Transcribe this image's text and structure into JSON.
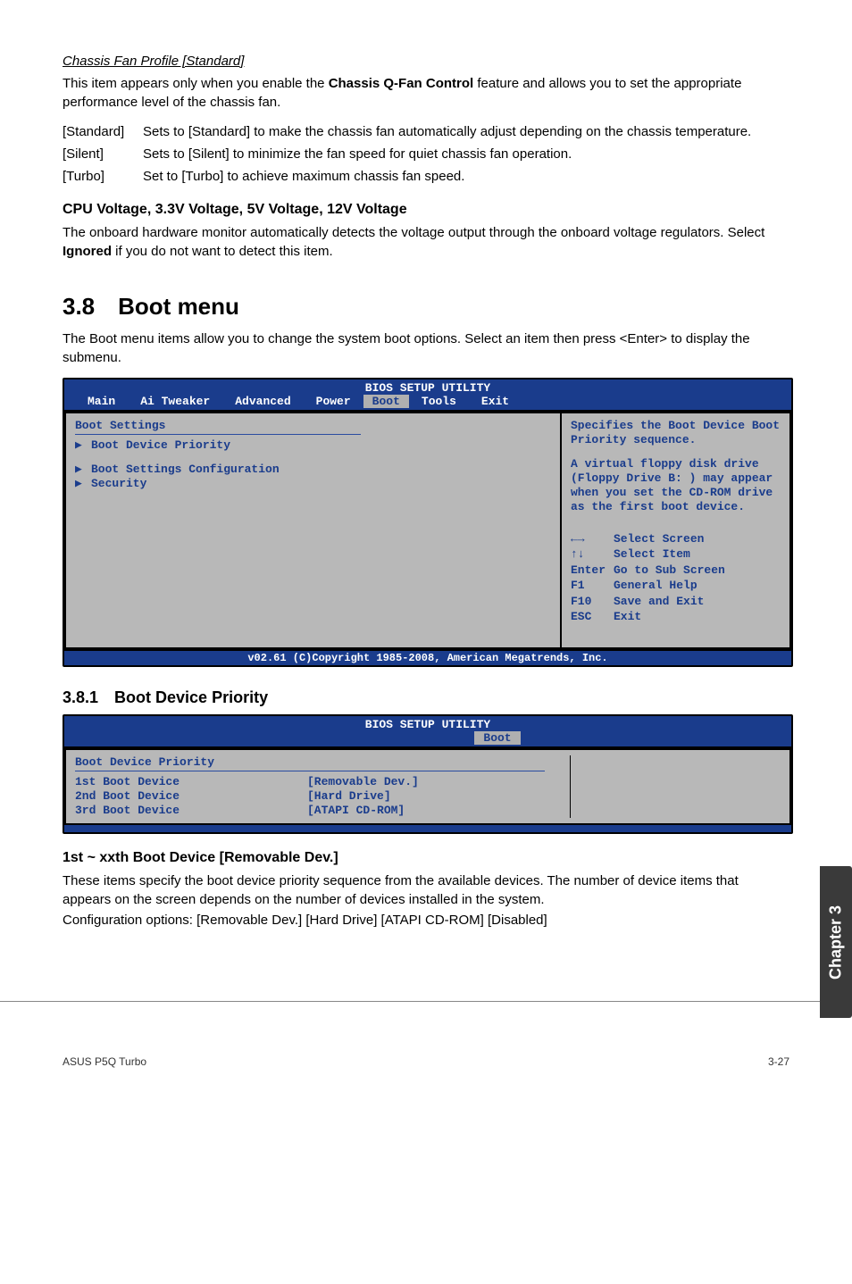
{
  "chassis_profile": {
    "heading": "Chassis Fan Profile [Standard]",
    "desc_pre": "This item appears only when you enable the ",
    "desc_bold": "Chassis Q-Fan Control",
    "desc_post": " feature and allows you to set the appropriate performance level of the chassis fan.",
    "options": [
      {
        "k": "[Standard]",
        "v": "Sets to [Standard] to make the chassis fan automatically adjust depending on the chassis temperature."
      },
      {
        "k": "[Silent]",
        "v": "Sets to [Silent] to minimize the fan speed for quiet chassis fan operation."
      },
      {
        "k": "[Turbo]",
        "v": "Set to [Turbo] to achieve maximum chassis fan speed."
      }
    ]
  },
  "cpu_voltage": {
    "heading": "CPU Voltage, 3.3V Voltage, 5V Voltage, 12V Voltage",
    "desc_pre": "The onboard hardware monitor automatically detects the voltage output through the onboard voltage regulators. Select ",
    "desc_bold": "Ignored",
    "desc_post": " if you do not want to detect this item."
  },
  "section_3_8": {
    "title": "3.8 Boot menu",
    "intro": "The Boot menu items allow you to change the system boot options. Select an item then press <Enter> to display the submenu."
  },
  "bios1": {
    "title": "BIOS SETUP UTILITY",
    "menus": [
      "Main",
      "Ai Tweaker",
      "Advanced",
      "Power",
      "Boot",
      "Tools",
      "Exit"
    ],
    "selected": "Boot",
    "left_header": "Boot Settings",
    "left_items": [
      "Boot Device Priority",
      "Boot Settings Configuration",
      "Security"
    ],
    "help1": "Specifies the Boot Device Boot Priority sequence.",
    "help2": "A virtual floppy disk drive (Floppy Drive B: ) may appear when you set the CD-ROM drive as the first boot device.",
    "keys": [
      {
        "k": "←→",
        "v": "Select Screen"
      },
      {
        "k": "↑↓",
        "v": "Select Item"
      },
      {
        "k": "Enter",
        "v": "Go to Sub Screen"
      },
      {
        "k": "F1",
        "v": "General Help"
      },
      {
        "k": "F10",
        "v": "Save and Exit"
      },
      {
        "k": "ESC",
        "v": "Exit"
      }
    ],
    "footer": "v02.61 (C)Copyright 1985-2008, American Megatrends, Inc."
  },
  "section_3_8_1": {
    "title": "3.8.1 Boot Device Priority"
  },
  "bios2": {
    "title": "BIOS SETUP UTILITY",
    "menu_selected": "Boot",
    "panel_header": "Boot Device Priority",
    "rows": [
      {
        "lbl": "1st Boot Device",
        "val": "[Removable Dev.]"
      },
      {
        "lbl": "2nd Boot Device",
        "val": "[Hard Drive]"
      },
      {
        "lbl": "3rd Boot Device",
        "val": "[ATAPI CD-ROM]"
      }
    ]
  },
  "boot_dev_section": {
    "heading": "1st ~ xxth Boot Device [Removable Dev.]",
    "p1": "These items specify the boot device priority sequence from the available devices. The number of device items that appears on the screen depends on the number of devices installed in the system.",
    "p2": "Configuration options: [Removable Dev.] [Hard Drive] [ATAPI CD-ROM] [Disabled]"
  },
  "sidetab": "Chapter 3",
  "footer": {
    "left": "ASUS P5Q Turbo",
    "right": "3-27"
  }
}
